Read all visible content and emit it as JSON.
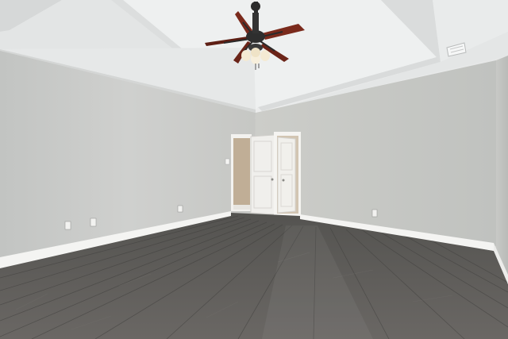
{
  "scene": {
    "kind": "empty-room-interior",
    "objects": [
      "ceiling-fan",
      "tray-ceiling",
      "open-doorway",
      "interior-door",
      "closet-door",
      "baseboards",
      "wall-outlets",
      "hvac-vent",
      "light-switch",
      "hardwood-floor"
    ]
  },
  "colors": {
    "ceiling": "#e8eaea",
    "tray": "#f2f3f3",
    "wall_left": "#c9cac7",
    "wall_right": "#c4c6c2",
    "floor": "#5a5855",
    "baseboard": "#f4f4f2",
    "door": "#f0efec",
    "fan_blade": "#7a2a1c",
    "fan_metal": "#2c2c2c"
  }
}
